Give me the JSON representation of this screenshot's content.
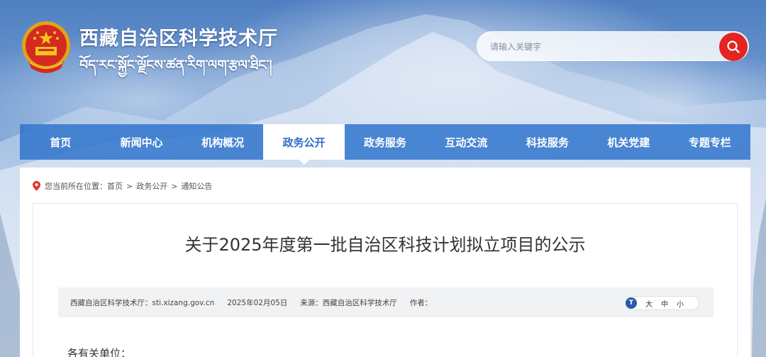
{
  "header": {
    "site_title": "西藏自治区科学技术厅",
    "site_subtitle": "བོད་རང་སྐྱོང་ལྗོངས་ཚན་རིག་ལག་རྩལ་ཐིང་།",
    "emblem_icon": "national-emblem-icon"
  },
  "search": {
    "placeholder": "请输入关键字",
    "button_icon": "search-icon",
    "button_color": "#e52320"
  },
  "nav": {
    "items": [
      {
        "label": "首页"
      },
      {
        "label": "新闻中心"
      },
      {
        "label": "机构概况"
      },
      {
        "label": "政务公开",
        "active": true
      },
      {
        "label": "政务服务"
      },
      {
        "label": "互动交流"
      },
      {
        "label": "科技服务"
      },
      {
        "label": "机关党建"
      },
      {
        "label": "专题专栏"
      }
    ],
    "active_color": "#2f6dc8"
  },
  "breadcrumb": {
    "prefix": "您当前所在位置：",
    "items": [
      "首页",
      "政务公开",
      "通知公告"
    ],
    "separator": ">",
    "icon": "location-pin-icon"
  },
  "article": {
    "title": "关于2025年度第一批自治区科技计划拟立项目的公示",
    "meta": {
      "site": "西藏自治区科学技术厅：sti.xizang.gov.cn",
      "date": "2025年02月05日",
      "source": "来源：西藏自治区科学技术厅",
      "author": "作者："
    },
    "font_size": {
      "icon_letter": "T",
      "options": [
        "大",
        "中",
        "小"
      ]
    },
    "greeting": "各有关单位："
  }
}
